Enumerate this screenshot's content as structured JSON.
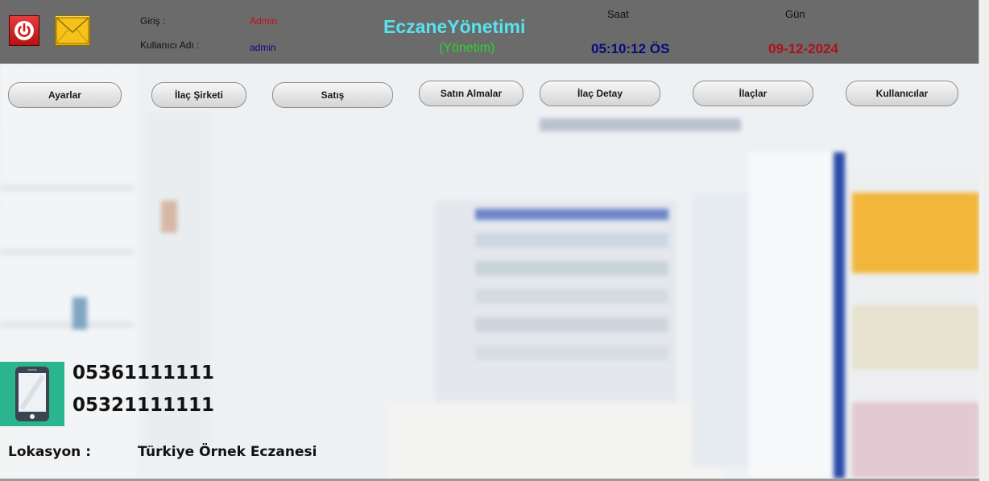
{
  "header": {
    "login_label": "Giriş :",
    "login_value": "Admin",
    "username_label": "Kullanıcı Adı :",
    "username_value": "admin",
    "app_title": "EczaneYönetimi",
    "app_subtitle": "(Yönetim)",
    "time_label": "Saat",
    "time_value": "05:10:12 ÖS",
    "date_label": "Gün",
    "date_value": "09-12-2024",
    "power_icon": "power-icon",
    "mail_icon": "mail-icon"
  },
  "nav": {
    "settings": "Ayarlar",
    "drug_company": "İlaç Şirketi",
    "sales": "Satış",
    "purchases": "Satın Almalar",
    "drug_detail": "İlaç Detay",
    "drugs": "İlaçlar",
    "users": "Kullanıcılar"
  },
  "contact": {
    "phone_icon": "mobile-phone-icon",
    "phone1": "05361111111",
    "phone2": "05321111111",
    "location_label": "Lokasyon :",
    "location_value": "Türkiye Örnek Eczanesi"
  },
  "colors": {
    "header_bg": "#6b6b6b",
    "title": "#57e3f0",
    "subtitle": "#2bd62b",
    "time": "#0a0a7a",
    "date": "#b0101a",
    "admin": "#c0101a",
    "username": "#0a0a7a",
    "phone_tile": "#2bb58e"
  }
}
